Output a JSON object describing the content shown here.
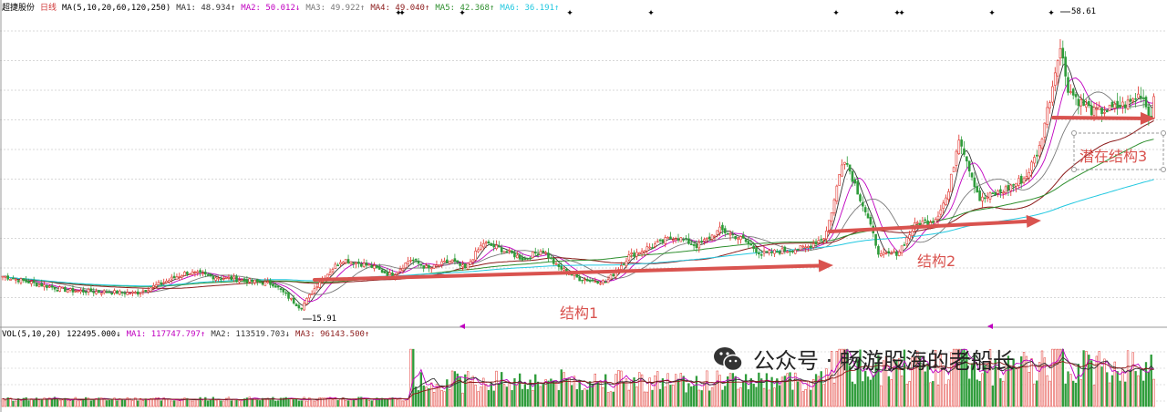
{
  "colors": {
    "up": "#e0302a",
    "down": "#2e9c3a",
    "ma1": "#333333",
    "ma2": "#c000c0",
    "ma3": "#7a7a7a",
    "ma4": "#8b1a1a",
    "ma5": "#2f8f2f",
    "ma6": "#22c8e0",
    "arrow": "#d9534f"
  },
  "price_header": {
    "name": "超捷股份",
    "period": "日线",
    "ma_params": "MA(5,10,20,60,120,250)",
    "ma1": "MA1: 48.934↑",
    "ma2": "MA2: 50.012↓",
    "ma3": "MA3: 49.922↑",
    "ma4": "MA4: 49.040↑",
    "ma5": "MA5: 42.368↑",
    "ma6": "MA6: 36.191↑"
  },
  "volume_header": {
    "params": "VOL(5,10,20)",
    "vol": "122495.000↓",
    "ma1": "MA1: 117747.797↑",
    "ma2": "MA2: 113519.703↓",
    "ma3": "MA3: 96143.500↑"
  },
  "annotations": {
    "s1": "结构1",
    "s2": "结构2",
    "s3": "潜在结构3",
    "high": "58.61",
    "low": "15.91"
  },
  "watermark": {
    "text": "公众号 · 畅游股海的老船长",
    "icon": "wechat-icon"
  },
  "chart_data": {
    "type": "candlestick",
    "y_range": [
      14,
      62
    ],
    "trend_close": [
      [
        0,
        21.5
      ],
      [
        40,
        20.2
      ],
      [
        75,
        19.2
      ],
      [
        110,
        19.0
      ],
      [
        150,
        18.8
      ],
      [
        180,
        20.5
      ],
      [
        205,
        22.0
      ],
      [
        235,
        21.3
      ],
      [
        265,
        20.8
      ],
      [
        300,
        20.2
      ],
      [
        330,
        16.5
      ],
      [
        350,
        20.5
      ],
      [
        375,
        24.0
      ],
      [
        405,
        23.0
      ],
      [
        430,
        21.5
      ],
      [
        450,
        24.0
      ],
      [
        470,
        22.5
      ],
      [
        495,
        23.8
      ],
      [
        510,
        22.5
      ],
      [
        530,
        26.5
      ],
      [
        550,
        25.5
      ],
      [
        575,
        24.0
      ],
      [
        595,
        25.5
      ],
      [
        610,
        23.0
      ],
      [
        635,
        21.0
      ],
      [
        665,
        20.5
      ],
      [
        690,
        24.5
      ],
      [
        715,
        26.0
      ],
      [
        740,
        27.5
      ],
      [
        765,
        26.0
      ],
      [
        790,
        28.5
      ],
      [
        815,
        27.0
      ],
      [
        835,
        24.8
      ],
      [
        860,
        25.3
      ],
      [
        885,
        25.8
      ],
      [
        905,
        27.5
      ],
      [
        915,
        33.0
      ],
      [
        925,
        40.0
      ],
      [
        935,
        36.5
      ],
      [
        950,
        31.0
      ],
      [
        965,
        24.5
      ],
      [
        985,
        25.0
      ],
      [
        1005,
        29.5
      ],
      [
        1025,
        30.0
      ],
      [
        1040,
        34.0
      ],
      [
        1052,
        43.0
      ],
      [
        1062,
        38.5
      ],
      [
        1075,
        33.0
      ],
      [
        1100,
        34.5
      ],
      [
        1125,
        36.5
      ],
      [
        1140,
        41.0
      ],
      [
        1155,
        51.0
      ],
      [
        1162,
        57.0
      ],
      [
        1172,
        50.0
      ],
      [
        1185,
        48.0
      ],
      [
        1200,
        46.5
      ],
      [
        1220,
        47.0
      ],
      [
        1240,
        48.0
      ],
      [
        1252,
        49.5
      ],
      [
        1262,
        45.5
      ],
      [
        1270,
        48.9
      ]
    ],
    "ma_targets": {
      "ma5_end": 42.368,
      "ma6_end": 36.191
    },
    "last_close": 48.9
  }
}
